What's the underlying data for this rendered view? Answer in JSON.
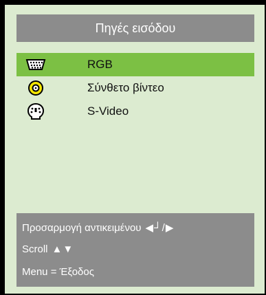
{
  "menu": {
    "title": "Πηγές εισόδου"
  },
  "sources": [
    {
      "label": "RGB",
      "icon": "vga-connector-icon",
      "selected": true
    },
    {
      "label": "Σύνθετο βίντεο",
      "icon": "composite-video-icon",
      "selected": false
    },
    {
      "label": "S-Video",
      "icon": "s-video-icon",
      "selected": false
    }
  ],
  "footer": {
    "adjust_label": "Προσαρμογή αντικειμένου",
    "adjust_glyphs": "◀┘/▶",
    "scroll_label": "Scroll",
    "scroll_glyphs": "▲▼",
    "menu_label": "Menu = Έξοδος"
  },
  "colors": {
    "panel_bg": "#dcebd0",
    "bar_gray": "#8c8c8c",
    "selected_green": "#7cc044",
    "composite_yellow": "#f5e600"
  }
}
